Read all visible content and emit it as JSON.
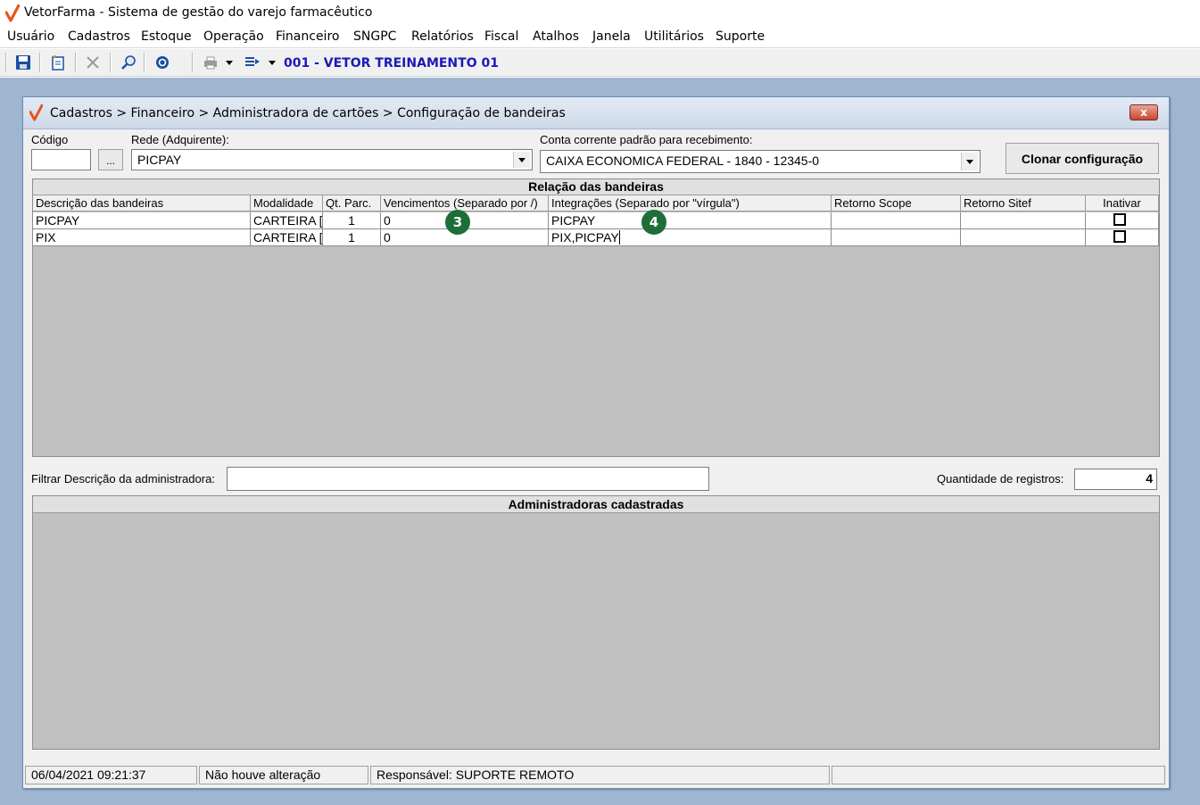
{
  "app": {
    "title": "VetorFarma - Sistema de gestão do varejo farmacêutico"
  },
  "menu": [
    "Usuário",
    "Cadastros",
    "Estoque",
    "Operação",
    "Financeiro",
    "SNGPC",
    "Relatórios",
    "Fiscal",
    "Atalhos",
    "Janela",
    "Utilitários",
    "Suporte"
  ],
  "toolbar": {
    "company": "001 - VETOR TREINAMENTO 01"
  },
  "window": {
    "title": "Cadastros > Financeiro > Administradora de cartões > Configuração de bandeiras",
    "close_label": "x"
  },
  "form": {
    "codigo_label": "Código",
    "codigo_value": "",
    "lookup_label": "...",
    "rede_label": "Rede (Adquirente):",
    "rede_value": "PICPAY",
    "conta_label": "Conta corrente padrão para recebimento:",
    "conta_value": "CAIXA ECONOMICA FEDERAL - 1840 - 12345-0",
    "clone_label": "Clonar configuração"
  },
  "bandeiras": {
    "caption": "Relação das bandeiras",
    "headers": [
      "Descrição das bandeiras",
      "Modalidade",
      "Qt. Parc.",
      "Vencimentos (Separado por /)",
      "Integrações (Separado por \"vírgula\")",
      "Retorno Scope",
      "Retorno Sitef",
      "Inativar"
    ],
    "rows": [
      {
        "descricao": "PICPAY",
        "modalidade": "CARTEIRA [",
        "qt_parc": "1",
        "vencimentos": "0",
        "integracoes": "PICPAY",
        "retorno_scope": "",
        "retorno_sitef": "",
        "inativar": false
      },
      {
        "descricao": "PIX",
        "modalidade": "CARTEIRA [",
        "qt_parc": "1",
        "vencimentos": "0",
        "integracoes": "PIX,PICPAY",
        "retorno_scope": "",
        "retorno_sitef": "",
        "inativar": false
      }
    ]
  },
  "badges": [
    "3",
    "4"
  ],
  "filter": {
    "label": "Filtrar Descrição da administradora:",
    "value": "",
    "count_label": "Quantidade de registros:",
    "count_value": "4"
  },
  "admins": {
    "caption": "Administradoras cadastradas"
  },
  "status": {
    "datetime": "06/04/2021 09:21:37",
    "change": "Não houve alteração",
    "responsible": "Responsável: SUPORTE REMOTO",
    "extra": ""
  },
  "colors": {
    "mdi_bg": "#9fb6d1",
    "company_text": "#1a1ab8",
    "badge": "#1e6e3a",
    "logo": "#e8541b"
  }
}
